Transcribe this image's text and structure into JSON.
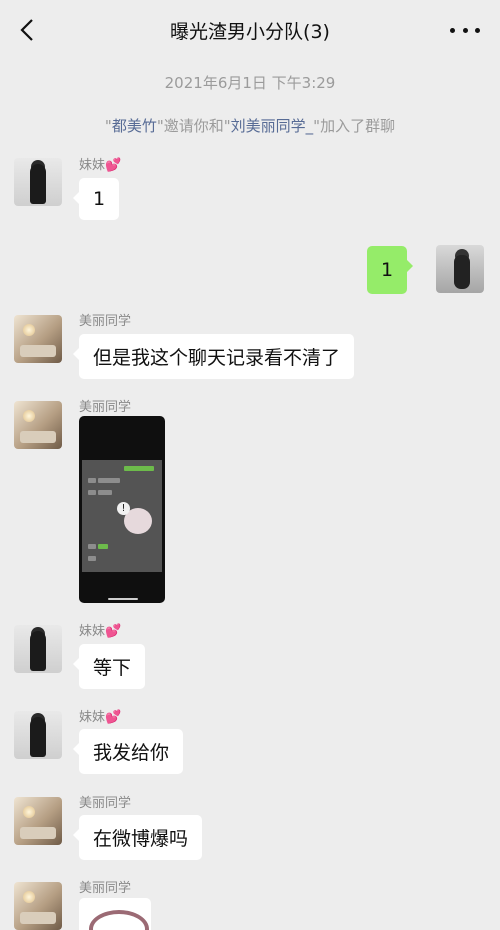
{
  "header": {
    "back_icon": "chevron-left-icon",
    "title": "曝光渣男小分队(3)",
    "more_icon": "more-dots-icon"
  },
  "timestamp": "2021年6月1日 下午3:29",
  "system_message": {
    "quote_open_1": "\"",
    "inviter": "都美竹",
    "mid": "\"邀请你和\"",
    "invitee": "刘美丽同学_",
    "tail": "\"加入了群聊"
  },
  "messages": [
    {
      "sender": "妹妹",
      "sender_suffix": "💕",
      "text": "1"
    },
    {
      "sender": "",
      "text": "1"
    },
    {
      "sender": "美丽同学",
      "text": "但是我这个聊天记录看不清了"
    },
    {
      "sender": "美丽同学",
      "text": ""
    },
    {
      "sender": "妹妹",
      "sender_suffix": "💕",
      "text": "等下"
    },
    {
      "sender": "妹妹",
      "sender_suffix": "💕",
      "text": "我发给你"
    },
    {
      "sender": "美丽同学",
      "text": "在微博爆吗"
    },
    {
      "sender": "美丽同学",
      "text": ""
    }
  ],
  "colors": {
    "background": "#ededed",
    "my_bubble": "#95ec69",
    "their_bubble": "#ffffff",
    "name_link": "#576b95"
  }
}
